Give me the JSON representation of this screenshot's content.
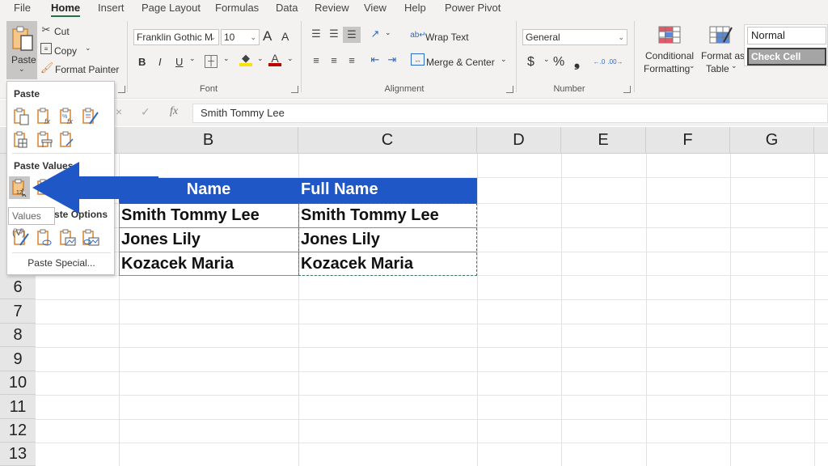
{
  "menu_tabs": [
    "File",
    "Home",
    "Insert",
    "Page Layout",
    "Formulas",
    "Data",
    "Review",
    "View",
    "Help",
    "Power Pivot"
  ],
  "active_tab": "Home",
  "ribbon": {
    "clipboard": {
      "paste_label": "Paste",
      "cut_label": "Cut",
      "copy_label": "Copy",
      "format_painter_label": "Format Painter"
    },
    "font": {
      "font_name": "Franklin Gothic M",
      "font_size": "10",
      "group_label": "Font",
      "bold": "B",
      "italic": "I",
      "underline": "U",
      "grow_font": "A",
      "shrink_font": "A"
    },
    "alignment": {
      "wrap_text_label": "Wrap Text",
      "merge_center_label": "Merge & Center",
      "group_label": "Alignment"
    },
    "number": {
      "format": "General",
      "group_label": "Number",
      "currency": "$",
      "percent": "%",
      "comma": "❟",
      "inc_decimal": "←.0 .00",
      "dec_decimal": ".00 →.0"
    },
    "styles": {
      "conditional_formatting_label": [
        "Conditional",
        "Formatting"
      ],
      "format_as_table_label": [
        "Format as",
        "Table"
      ],
      "style_normal": "Normal",
      "style_check_cell": "Check Cell"
    }
  },
  "paste_menu": {
    "section_paste": "Paste",
    "section_paste_values": "Paste Values",
    "section_other": "Other Paste Options",
    "section_other_visible": "te Options",
    "paste_special": "Paste Special...",
    "tooltip": "Values (V)"
  },
  "formula_bar": {
    "cancel_icon": "×",
    "enter_icon": "✓",
    "fx_label": "fx",
    "content": "Smith Tommy Lee"
  },
  "columns": [
    "B",
    "C",
    "D",
    "E",
    "F",
    "G"
  ],
  "row_numbers_visible": [
    "6",
    "7",
    "8",
    "9",
    "10",
    "11",
    "12",
    "13"
  ],
  "table": {
    "headers": [
      "Name",
      "Full Name"
    ],
    "rows": [
      [
        "Smith Tommy Lee",
        "Smith Tommy Lee"
      ],
      [
        "Jones Lily",
        "Jones Lily"
      ],
      [
        "Kozacek Maria",
        "Kozacek Maria"
      ]
    ],
    "header_color": "#1f57c7"
  },
  "annotation": {
    "arrow_color": "#1f57c7",
    "arrow_points_to": "Paste Values - Values (V)"
  }
}
